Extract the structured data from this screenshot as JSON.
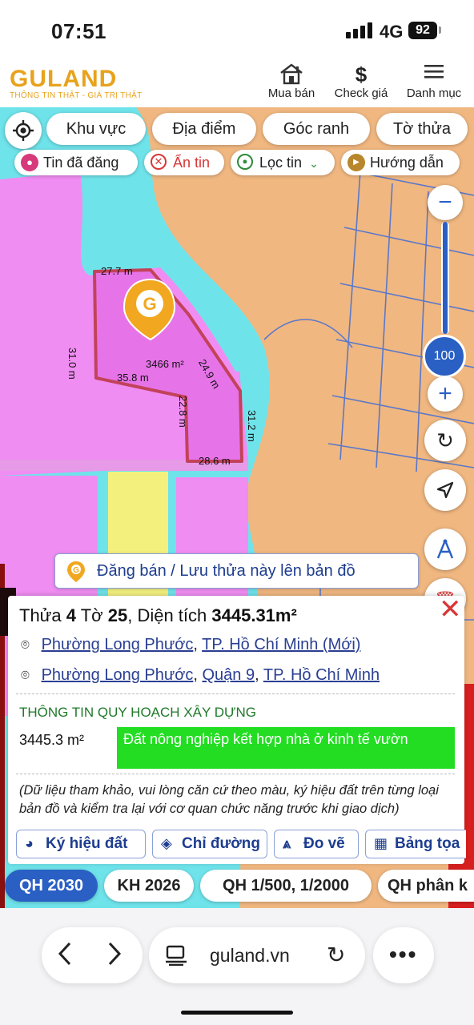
{
  "status": {
    "time": "07:51",
    "network": "4G",
    "battery": "92"
  },
  "header": {
    "logo": "GULAND",
    "tagline": "THÔNG TIN THẬT - GIÁ TRỊ THẬT",
    "buttons": [
      {
        "label": "Mua bán",
        "icon": "house-icon"
      },
      {
        "label": "Check giá",
        "icon": "dollar-icon"
      },
      {
        "label": "Danh mục",
        "icon": "menu-icon"
      }
    ]
  },
  "search_chips": [
    "Khu vực",
    "Địa điểm",
    "Góc ranh",
    "Tờ thửa"
  ],
  "filter_pills": [
    {
      "label": "Tin đã đăng",
      "icon": "palette-icon",
      "color": "#d63a7a"
    },
    {
      "label": "Ẩn tin",
      "icon": "close-circle-icon",
      "color": "#d93636"
    },
    {
      "label": "Lọc tin",
      "icon": "location-icon",
      "color": "#2e8b3a"
    },
    {
      "label": "Hướng dẫn",
      "icon": "play-icon",
      "color": "#b8862b"
    }
  ],
  "zoom_level": "100",
  "map_labels": {
    "m1": "27.7 m",
    "m2": "31.0 m",
    "m3": "24.9 m",
    "m4": "35.8 m",
    "area": "3466 m²",
    "m5": "22.8 m",
    "m6": "31.2 m",
    "m7": "28.6 m"
  },
  "post_banner": "Đăng bán / Lưu thửa này lên bản đồ",
  "parcel": {
    "thua_label": "Thửa",
    "thua": "4",
    "to_label": "Tờ",
    "to": "25",
    "dt_label": ", Diện tích",
    "area": "3445.31m²",
    "addr1": [
      "Phường Long Phước",
      "TP. Hồ Chí Minh (Mới)"
    ],
    "addr2": [
      "Phường Long Phước",
      "Quận 9",
      "TP. Hồ Chí Minh"
    ],
    "section_title": "THÔNG TIN QUY HOẠCH XÂY DỰNG",
    "plan_area": "3445.3 m²",
    "plan_type": "Đất nông nghiệp kết hợp nhà ở kinh tế vườn",
    "note": "(Dữ liệu tham khảo, vui lòng căn cứ theo màu, ký hiệu đất trên từng loại bản đồ và kiểm tra lại với cơ quan chức năng trước khi giao dịch)"
  },
  "actions": [
    "Ký hiệu đất",
    "Chỉ đường",
    "Đo vẽ",
    "Bảng tọa"
  ],
  "layers": [
    "QH 2030",
    "KH 2026",
    "QH 1/500, 1/2000",
    "QH phân k"
  ],
  "browser": {
    "url": "guland.vn"
  },
  "colors": {
    "brand": "#e8a21c",
    "accent": "#2a5fc4",
    "plan_green": "#22dd22",
    "zone_pink": "#f08df2",
    "zone_orange": "#f0b781",
    "water_cyan": "#6fe3ea"
  }
}
